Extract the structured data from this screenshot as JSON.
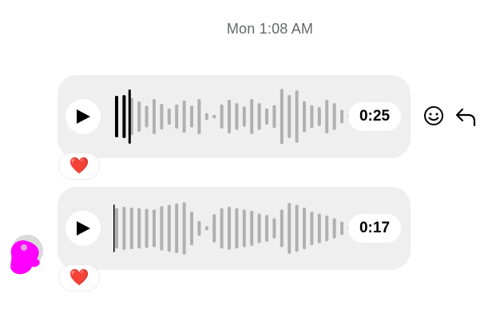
{
  "thread": {
    "timestamp": "Mon 1:08 AM",
    "messages": [
      {
        "duration": "0:25",
        "progress": 0.07,
        "reaction": "❤️",
        "waveform": [
          0.62,
          0.64,
          0.55,
          0.45,
          0.32,
          0.52,
          0.38,
          0.24,
          0.36,
          0.48,
          0.32,
          0.52,
          0.1,
          0.05,
          0.36,
          0.5,
          0.4,
          0.3,
          0.52,
          0.4,
          0.24,
          0.34,
          0.82,
          0.64,
          0.78,
          0.46,
          0.34,
          0.28,
          0.5,
          0.4,
          0.2,
          0.06
        ]
      },
      {
        "duration": "0:17",
        "progress": 0.0,
        "reaction": "❤️",
        "waveform": [
          0.6,
          0.64,
          0.62,
          0.6,
          0.58,
          0.56,
          0.66,
          0.7,
          0.74,
          0.78,
          0.5,
          0.22,
          0.06,
          0.42,
          0.6,
          0.64,
          0.6,
          0.56,
          0.52,
          0.44,
          0.4,
          0.3,
          0.56,
          0.76,
          0.7,
          0.62,
          0.5,
          0.44,
          0.38,
          0.3,
          0.2,
          0.06
        ]
      }
    ]
  },
  "colors": {
    "bubble": "#efefef",
    "played": "#000000",
    "unplayed": "#b0b0b0",
    "avatar": "#ff00ff"
  },
  "icons": {
    "play": "play-icon",
    "react": "smiley-icon",
    "reply": "reply-icon"
  }
}
